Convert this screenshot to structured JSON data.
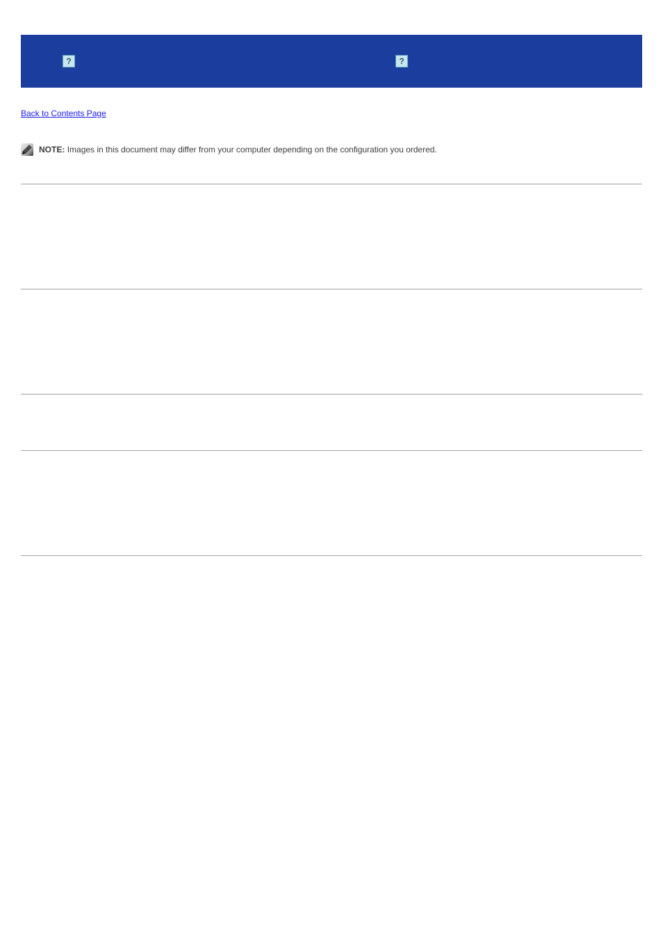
{
  "header": {
    "left_label": "",
    "right_label": ""
  },
  "breadcrumb": {
    "back_label": "Back to Contents Page"
  },
  "note": {
    "prefix": "NOTE:",
    "body": "Images in this document may differ from your computer depending on the configuration you ordered."
  },
  "sections": [
    {
      "title": "",
      "body": ""
    },
    {
      "title": "",
      "body": ""
    },
    {
      "title": "",
      "body": ""
    },
    {
      "title": "",
      "body": ""
    },
    {
      "title": "",
      "body": ""
    }
  ]
}
